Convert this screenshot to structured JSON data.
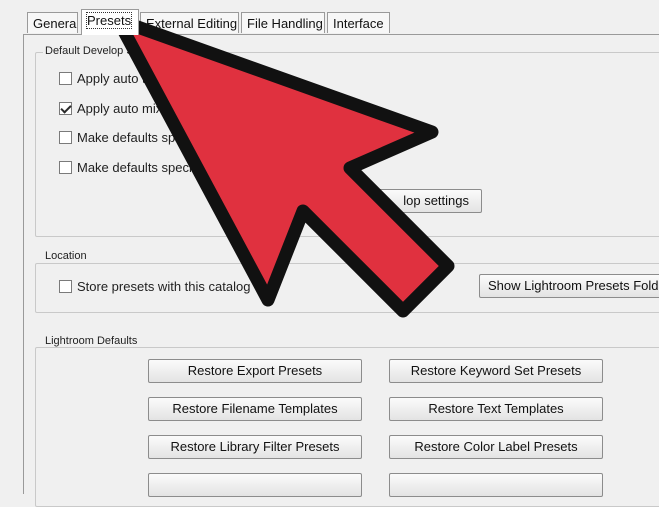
{
  "tabs": [
    {
      "label": "General",
      "active": false
    },
    {
      "label": "Presets",
      "active": true
    },
    {
      "label": "External Editing",
      "active": false
    },
    {
      "label": "File Handling",
      "active": false
    },
    {
      "label": "Interface",
      "active": false
    }
  ],
  "default_develop": {
    "title": "Default Develop S",
    "options": [
      {
        "label": "Apply auto t",
        "checked": false
      },
      {
        "label": "Apply auto mix",
        "checked": true
      },
      {
        "label": "Make defaults spe",
        "checked": false
      },
      {
        "label": "Make defaults speci",
        "checked": false
      }
    ],
    "reset_button_label": "lop settings"
  },
  "location": {
    "title": "Location",
    "store_label": "Store presets with this catalog",
    "store_checked": false,
    "show_folder_label": "Show Lightroom Presets Folde"
  },
  "lightroom_defaults": {
    "title": "Lightroom Defaults",
    "buttons": [
      "Restore Export Presets",
      "Restore Keyword Set Presets",
      "Restore Filename Templates",
      "Restore Text Templates",
      "Restore Library Filter Presets",
      "Restore Color Label Presets"
    ]
  },
  "overlay": {
    "arrow_icon": "red-arrow-pointer-icon",
    "arrow_color": "#e0313f",
    "outline_color": "#111111"
  }
}
